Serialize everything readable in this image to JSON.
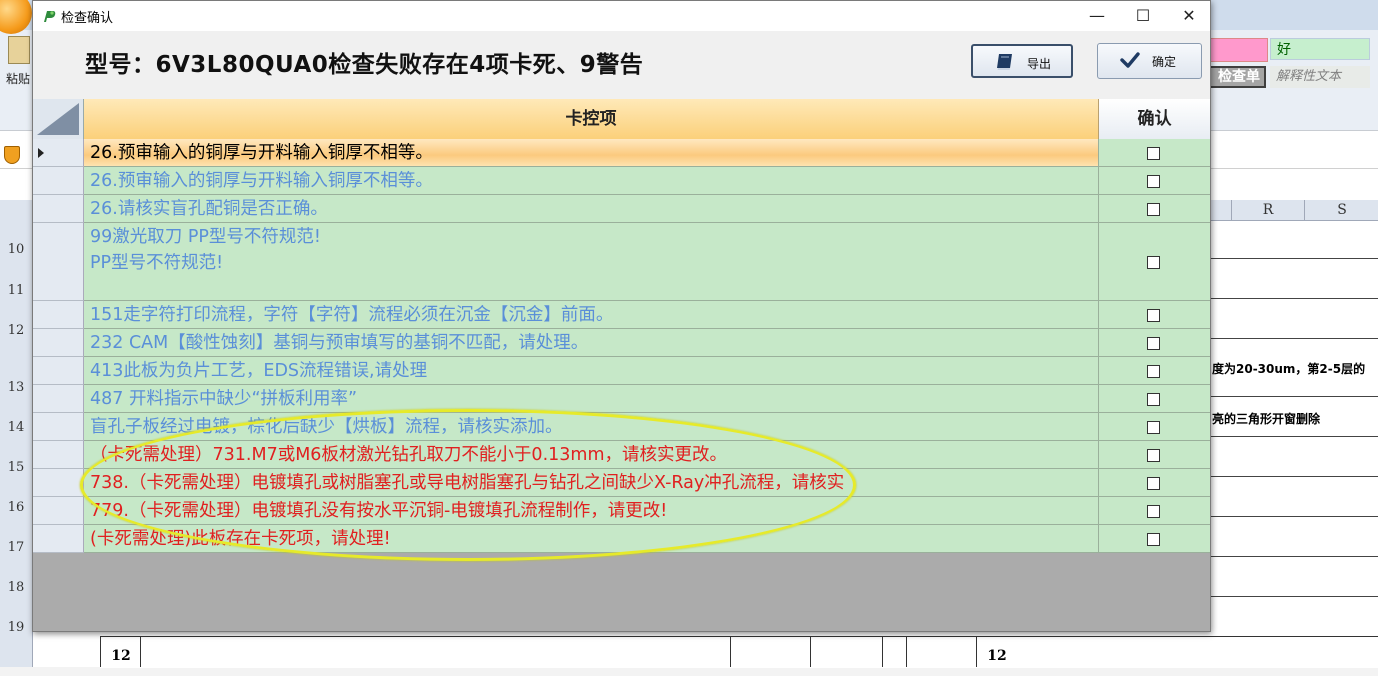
{
  "background_app": {
    "paste_label": "粘贴",
    "styles": {
      "good": "好",
      "check_cell": "检查单元格",
      "explanatory": "解释性文本"
    },
    "columns": [
      "R",
      "S"
    ],
    "row_numbers": [
      "10",
      "11",
      "12",
      "13",
      "14",
      "15",
      "16",
      "17",
      "18",
      "19"
    ],
    "cell_text_13": "度为20-30um，第2-5层的",
    "cell_text_14": "亮的三角形开窗删除",
    "bottom_cell_left": "12",
    "bottom_cell_right": "12"
  },
  "dialog": {
    "title": "检查确认",
    "headline": "型号：6V3L80QUA0检查失败存在4项卡死、9警告",
    "export_label": "导出",
    "confirm_label": "确定"
  },
  "grid": {
    "col_item": "卡控项",
    "col_confirm": "确认",
    "rows": [
      {
        "text": "26.预审输入的铜厚与开料输入铜厚不相等。",
        "color": "black",
        "checked": false
      },
      {
        "text": "26.预审输入的铜厚与开料输入铜厚不相等。",
        "color": "blue",
        "checked": false
      },
      {
        "text": "26.请核实盲孔配铜是否正确。",
        "color": "blue",
        "checked": false
      },
      {
        "text": "99激光取刀 PP型号不符规范!\nPP型号不符规范!",
        "color": "blue",
        "checked": false
      },
      {
        "text": "151走字符打印流程，字符【字符】流程必须在沉金【沉金】前面。",
        "color": "blue",
        "checked": false
      },
      {
        "text": "232 CAM【酸性蚀刻】基铜与预审填写的基铜不匹配，请处理。",
        "color": "blue",
        "checked": false
      },
      {
        "text": "413此板为负片工艺，EDS流程错误,请处理",
        "color": "blue",
        "checked": false
      },
      {
        "text": "487 开料指示中缺少“拼板利用率”",
        "color": "blue",
        "checked": false
      },
      {
        "text": "盲孔子板经过电镀，棕化后缺少【烘板】流程，请核实添加。",
        "color": "blue",
        "checked": false
      },
      {
        "text": "（卡死需处理）731.M7或M6板材激光钻孔取刀不能小于0.13mm，请核实更改。",
        "color": "red",
        "checked": false
      },
      {
        "text": "738.（卡死需处理）电镀填孔或树脂塞孔或导电树脂塞孔与钻孔之间缺少X-Ray冲孔流程，请核实",
        "color": "red",
        "checked": false
      },
      {
        "text": "779.（卡死需处理）电镀填孔没有按水平沉铜-电镀填孔流程制作，请更改!",
        "color": "red",
        "checked": false
      },
      {
        "text": "(卡死需处理)此板存在卡死项，请处理!",
        "color": "red",
        "checked": false
      }
    ]
  }
}
